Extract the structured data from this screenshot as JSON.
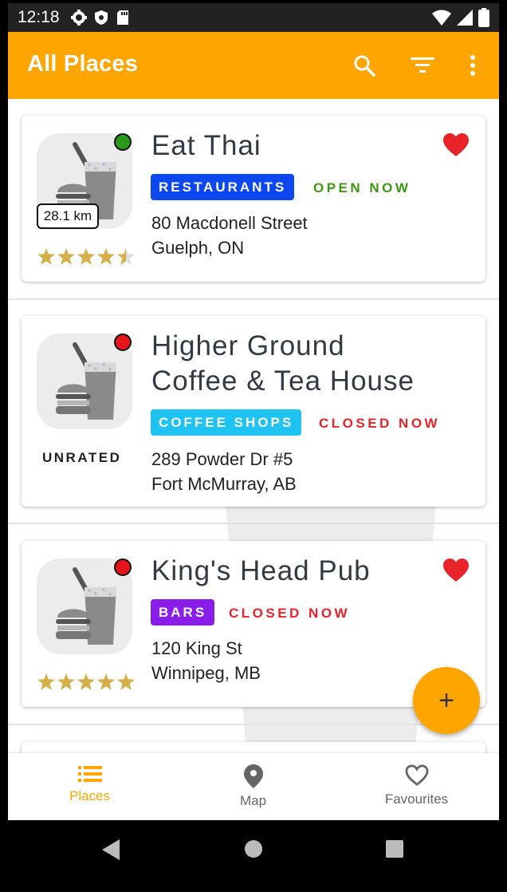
{
  "status_bar": {
    "time": "12:18"
  },
  "toolbar": {
    "title": "All Places",
    "search_icon": "search-icon",
    "filter_icon": "filter-icon",
    "more_icon": "more-vert-icon",
    "color": "#FFA500"
  },
  "places": [
    {
      "name_line1": "Eat Thai",
      "name_line2": "",
      "category": "RESTAURANTS",
      "category_color": "#0d47f0",
      "status": "OPEN NOW",
      "status_color": "#3a9a12",
      "status_dot_color": "#2a9a1a",
      "distance": "28.1 km",
      "rating": 4.5,
      "rating_text": "",
      "address_line1": "80 Macdonell Street",
      "address_line2": "Guelph, ON",
      "favourite": true
    },
    {
      "name_line1": "Higher Ground",
      "name_line2": "Coffee & Tea House",
      "category": "COFFEE SHOPS",
      "category_color": "#1ec3f2",
      "status": "CLOSED NOW",
      "status_color": "#e8232a",
      "status_dot_color": "#e8141b",
      "distance": "",
      "rating": 0,
      "rating_text": "UNRATED",
      "address_line1": "289 Powder Dr #5",
      "address_line2": "Fort McMurray, AB",
      "favourite": false
    },
    {
      "name_line1": "King's Head Pub",
      "name_line2": "",
      "category": "BARS",
      "category_color": "#8a1ee8",
      "status": "CLOSED NOW",
      "status_color": "#e8232a",
      "status_dot_color": "#e8141b",
      "distance": "",
      "rating": 5,
      "rating_text": "",
      "address_line1": "120 King St",
      "address_line2": "Winnipeg, MB",
      "favourite": true
    }
  ],
  "fab": {
    "label": "+",
    "icon": "add-icon"
  },
  "bottom_nav": [
    {
      "label": "Places",
      "icon": "list-icon",
      "active": true
    },
    {
      "label": "Map",
      "icon": "map-pin-icon",
      "active": false
    },
    {
      "label": "Favourites",
      "icon": "heart-outline-icon",
      "active": false
    }
  ],
  "colors": {
    "accent": "#FFA500",
    "inactive": "#666666",
    "star": "#d4b04a",
    "heart": "#e8232a"
  }
}
